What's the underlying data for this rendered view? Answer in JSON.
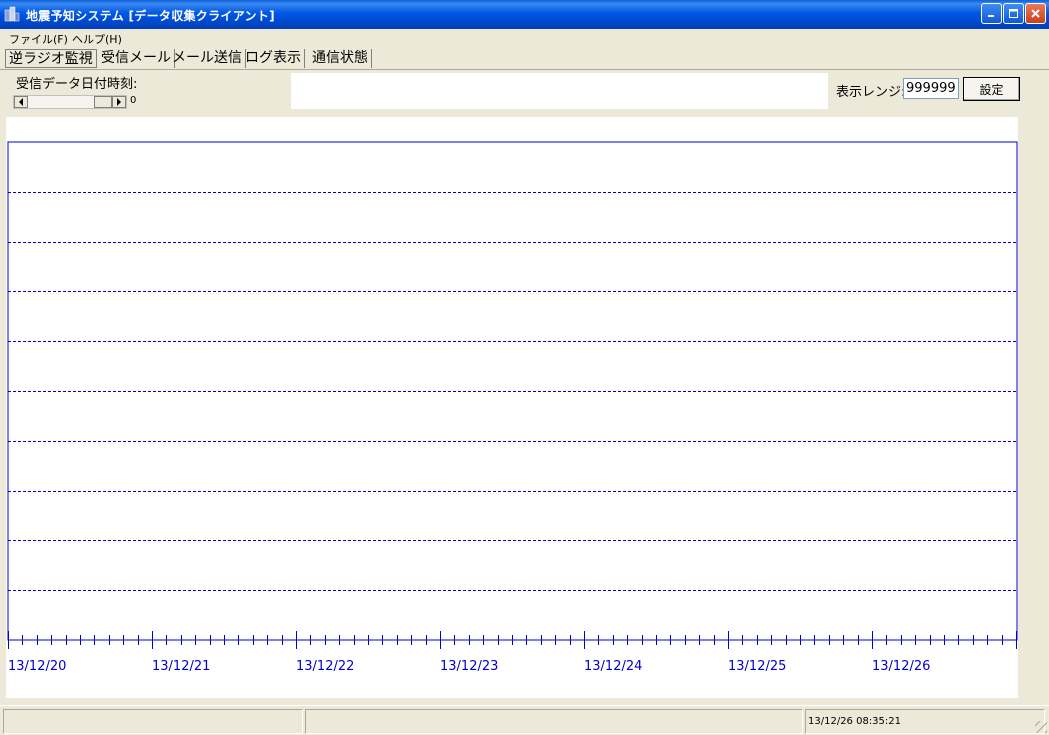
{
  "window": {
    "title": "地震予知システム [データ収集クライアント]",
    "icon": "app-building-icon"
  },
  "menu": [
    "ファイル(F)",
    "ヘルプ(H)"
  ],
  "tabs": [
    {
      "label": "逆ラジオ監視",
      "active": true
    },
    {
      "label": "受信メール",
      "active": false
    },
    {
      "label": "メール送信",
      "active": false
    },
    {
      "label": "ログ表示",
      "active": false
    },
    {
      "label": "通信状態",
      "active": false
    }
  ],
  "controls": {
    "received_datetime_label": "受信データ日付時刻:",
    "scroll_value": "0",
    "range_label": "表示レンジ:",
    "range_value": "999999",
    "set_button": "設定"
  },
  "chart_data": {
    "type": "line",
    "x_tick_labels": [
      "13/12/20",
      "13/12/21",
      "13/12/22",
      "13/12/23",
      "13/12/24",
      "13/12/25",
      "13/12/26"
    ],
    "horizontal_gridlines": 9,
    "minor_ticks_per_day": 10,
    "series": [],
    "grid": true,
    "line_color": "#0000cc"
  },
  "status": {
    "panels": [
      "",
      "",
      "13/12/26 08:35:21"
    ]
  },
  "colors": {
    "titlebar": "#0054e3",
    "face": "#ece9d8",
    "chart_line": "#0000cc"
  }
}
